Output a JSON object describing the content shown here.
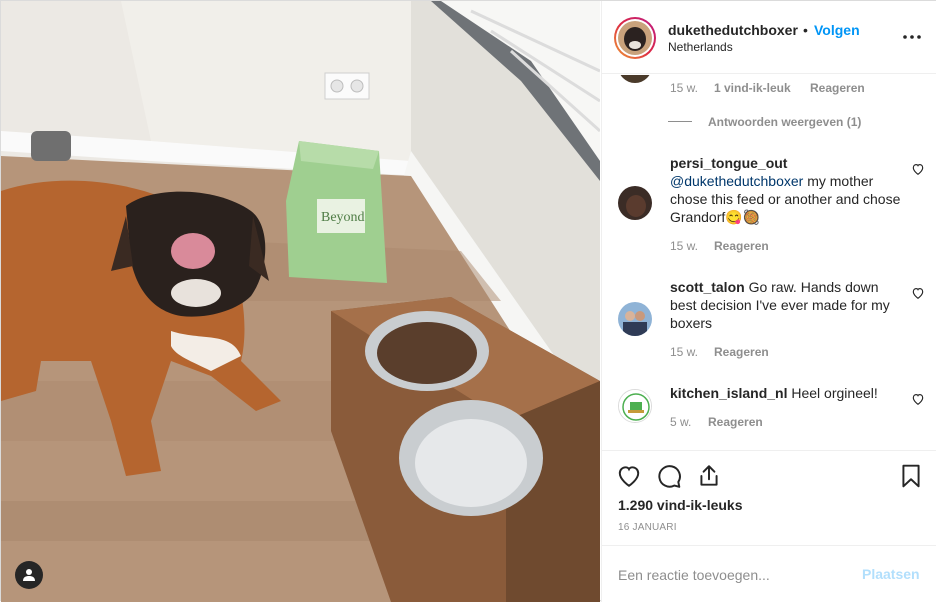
{
  "post": {
    "author": "dukethedutchboxer",
    "separator": "•",
    "follow_label": "Volgen",
    "location": "Netherlands",
    "more_icon": "more-horizontal-icon"
  },
  "comments": {
    "partial": {
      "age": "15 w.",
      "likes": "1 vind-ik-leuk",
      "reply": "Reageren"
    },
    "view_replies": "Antwoorden weergeven (1)",
    "items": [
      {
        "username": "persi_tongue_out",
        "mention": "@dukethedutchboxer",
        "text": " my mother chose this feed or another and chose Grandorf😋🥘",
        "age": "15 w.",
        "reply": "Reageren"
      },
      {
        "username": "scott_talon",
        "text": " Go raw. Hands down best decision I've ever made for my boxers",
        "age": "15 w.",
        "reply": "Reageren"
      },
      {
        "username": "kitchen_island_nl",
        "text": " Heel orgineel!",
        "age": "5 w.",
        "reply": "Reageren"
      }
    ]
  },
  "actions": {
    "likes": "1.290 vind-ik-leuks",
    "date": "16 JANUARI"
  },
  "add_comment": {
    "placeholder": "Een reactie toevoegen...",
    "submit": "Plaatsen"
  },
  "colors": {
    "accent": "#0095f6",
    "muted": "#8e8e8e",
    "submit_disabled": "#b2dffc"
  }
}
